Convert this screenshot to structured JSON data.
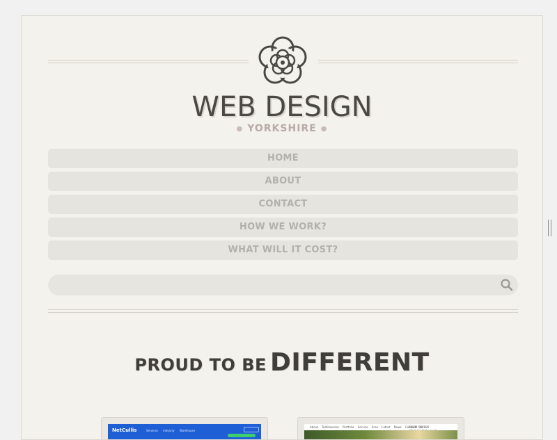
{
  "logo": {
    "title": "WEB DESIGN",
    "subtitle": "YORKSHIRE",
    "icon": "yorkshire-rose-icon"
  },
  "nav": {
    "items": [
      {
        "label": "HOME"
      },
      {
        "label": "ABOUT"
      },
      {
        "label": "CONTACT"
      },
      {
        "label": "HOW WE WORK?"
      },
      {
        "label": "WHAT WILL IT COST?"
      }
    ]
  },
  "search": {
    "placeholder": "",
    "icon": "search-icon"
  },
  "tagline": {
    "small": "PROUD TO BE",
    "big": "DIFFERENT"
  },
  "portfolio": {
    "thumb1": {
      "logo": "NetCullis",
      "nav": "Services Industry Warehouse",
      "phone": "0 20 0000 000"
    },
    "thumb2": {
      "nav": "About Testimonials Portfolio Service Area Latest News Contact Us",
      "contact": "01234 567890 info@example.co.uk"
    }
  },
  "colors": {
    "background": "#f4f2ec",
    "nav_bg": "#e6e4df",
    "nav_text": "#b3b1ac",
    "title_text": "#4a4844",
    "subtitle_text": "#b8aaa6"
  }
}
